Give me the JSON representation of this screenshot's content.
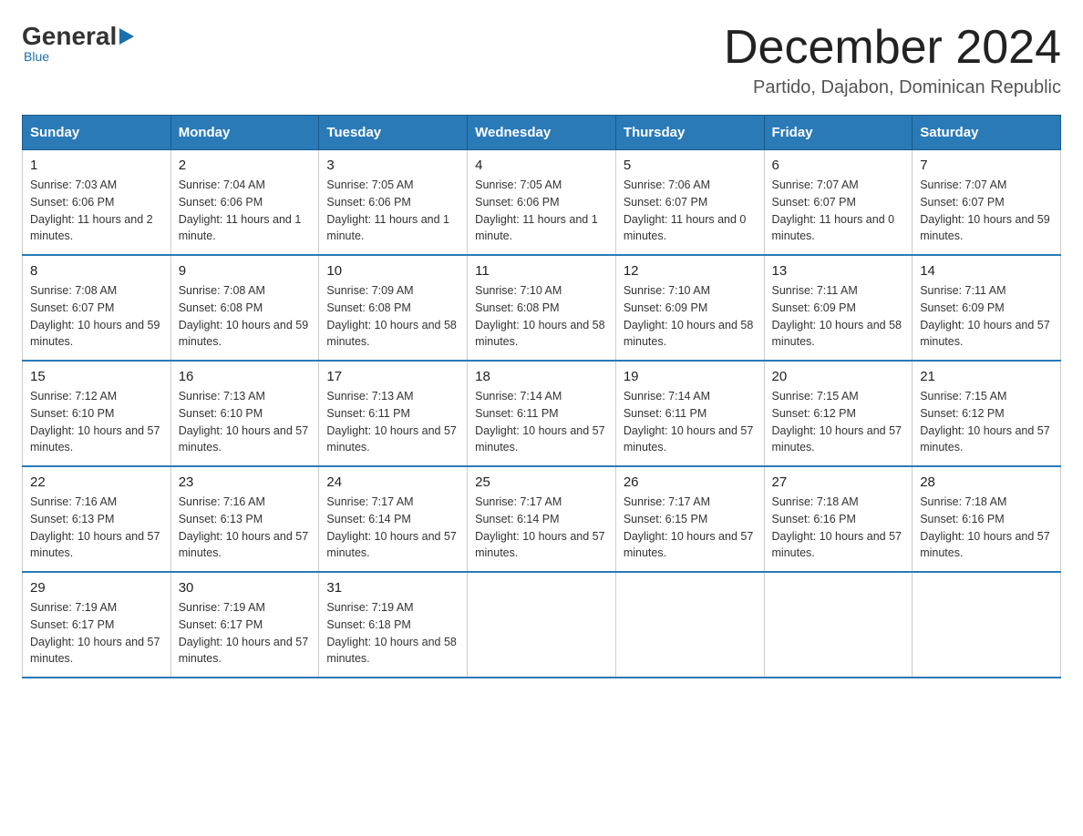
{
  "header": {
    "logo_general": "General",
    "logo_blue": "Blue",
    "logo_sub": "Blue",
    "title": "December 2024",
    "subtitle": "Partido, Dajabon, Dominican Republic"
  },
  "days_of_week": [
    "Sunday",
    "Monday",
    "Tuesday",
    "Wednesday",
    "Thursday",
    "Friday",
    "Saturday"
  ],
  "weeks": [
    [
      {
        "day": "1",
        "sunrise": "7:03 AM",
        "sunset": "6:06 PM",
        "daylight": "11 hours and 2 minutes."
      },
      {
        "day": "2",
        "sunrise": "7:04 AM",
        "sunset": "6:06 PM",
        "daylight": "11 hours and 1 minute."
      },
      {
        "day": "3",
        "sunrise": "7:05 AM",
        "sunset": "6:06 PM",
        "daylight": "11 hours and 1 minute."
      },
      {
        "day": "4",
        "sunrise": "7:05 AM",
        "sunset": "6:06 PM",
        "daylight": "11 hours and 1 minute."
      },
      {
        "day": "5",
        "sunrise": "7:06 AM",
        "sunset": "6:07 PM",
        "daylight": "11 hours and 0 minutes."
      },
      {
        "day": "6",
        "sunrise": "7:07 AM",
        "sunset": "6:07 PM",
        "daylight": "11 hours and 0 minutes."
      },
      {
        "day": "7",
        "sunrise": "7:07 AM",
        "sunset": "6:07 PM",
        "daylight": "10 hours and 59 minutes."
      }
    ],
    [
      {
        "day": "8",
        "sunrise": "7:08 AM",
        "sunset": "6:07 PM",
        "daylight": "10 hours and 59 minutes."
      },
      {
        "day": "9",
        "sunrise": "7:08 AM",
        "sunset": "6:08 PM",
        "daylight": "10 hours and 59 minutes."
      },
      {
        "day": "10",
        "sunrise": "7:09 AM",
        "sunset": "6:08 PM",
        "daylight": "10 hours and 58 minutes."
      },
      {
        "day": "11",
        "sunrise": "7:10 AM",
        "sunset": "6:08 PM",
        "daylight": "10 hours and 58 minutes."
      },
      {
        "day": "12",
        "sunrise": "7:10 AM",
        "sunset": "6:09 PM",
        "daylight": "10 hours and 58 minutes."
      },
      {
        "day": "13",
        "sunrise": "7:11 AM",
        "sunset": "6:09 PM",
        "daylight": "10 hours and 58 minutes."
      },
      {
        "day": "14",
        "sunrise": "7:11 AM",
        "sunset": "6:09 PM",
        "daylight": "10 hours and 57 minutes."
      }
    ],
    [
      {
        "day": "15",
        "sunrise": "7:12 AM",
        "sunset": "6:10 PM",
        "daylight": "10 hours and 57 minutes."
      },
      {
        "day": "16",
        "sunrise": "7:13 AM",
        "sunset": "6:10 PM",
        "daylight": "10 hours and 57 minutes."
      },
      {
        "day": "17",
        "sunrise": "7:13 AM",
        "sunset": "6:11 PM",
        "daylight": "10 hours and 57 minutes."
      },
      {
        "day": "18",
        "sunrise": "7:14 AM",
        "sunset": "6:11 PM",
        "daylight": "10 hours and 57 minutes."
      },
      {
        "day": "19",
        "sunrise": "7:14 AM",
        "sunset": "6:11 PM",
        "daylight": "10 hours and 57 minutes."
      },
      {
        "day": "20",
        "sunrise": "7:15 AM",
        "sunset": "6:12 PM",
        "daylight": "10 hours and 57 minutes."
      },
      {
        "day": "21",
        "sunrise": "7:15 AM",
        "sunset": "6:12 PM",
        "daylight": "10 hours and 57 minutes."
      }
    ],
    [
      {
        "day": "22",
        "sunrise": "7:16 AM",
        "sunset": "6:13 PM",
        "daylight": "10 hours and 57 minutes."
      },
      {
        "day": "23",
        "sunrise": "7:16 AM",
        "sunset": "6:13 PM",
        "daylight": "10 hours and 57 minutes."
      },
      {
        "day": "24",
        "sunrise": "7:17 AM",
        "sunset": "6:14 PM",
        "daylight": "10 hours and 57 minutes."
      },
      {
        "day": "25",
        "sunrise": "7:17 AM",
        "sunset": "6:14 PM",
        "daylight": "10 hours and 57 minutes."
      },
      {
        "day": "26",
        "sunrise": "7:17 AM",
        "sunset": "6:15 PM",
        "daylight": "10 hours and 57 minutes."
      },
      {
        "day": "27",
        "sunrise": "7:18 AM",
        "sunset": "6:16 PM",
        "daylight": "10 hours and 57 minutes."
      },
      {
        "day": "28",
        "sunrise": "7:18 AM",
        "sunset": "6:16 PM",
        "daylight": "10 hours and 57 minutes."
      }
    ],
    [
      {
        "day": "29",
        "sunrise": "7:19 AM",
        "sunset": "6:17 PM",
        "daylight": "10 hours and 57 minutes."
      },
      {
        "day": "30",
        "sunrise": "7:19 AM",
        "sunset": "6:17 PM",
        "daylight": "10 hours and 57 minutes."
      },
      {
        "day": "31",
        "sunrise": "7:19 AM",
        "sunset": "6:18 PM",
        "daylight": "10 hours and 58 minutes."
      },
      null,
      null,
      null,
      null
    ]
  ]
}
